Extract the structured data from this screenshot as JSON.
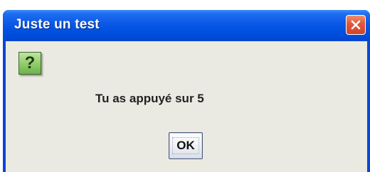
{
  "window": {
    "title": "Juste un test"
  },
  "dialog": {
    "icon": "question-icon",
    "icon_glyph": "?",
    "message": "Tu as appuyé sur 5",
    "ok_label": "OK"
  },
  "colors": {
    "titlebar": "#0050e0",
    "close_button": "#e2563a",
    "content_bg": "#ebeae2",
    "icon_green": "#8fcb6a"
  }
}
